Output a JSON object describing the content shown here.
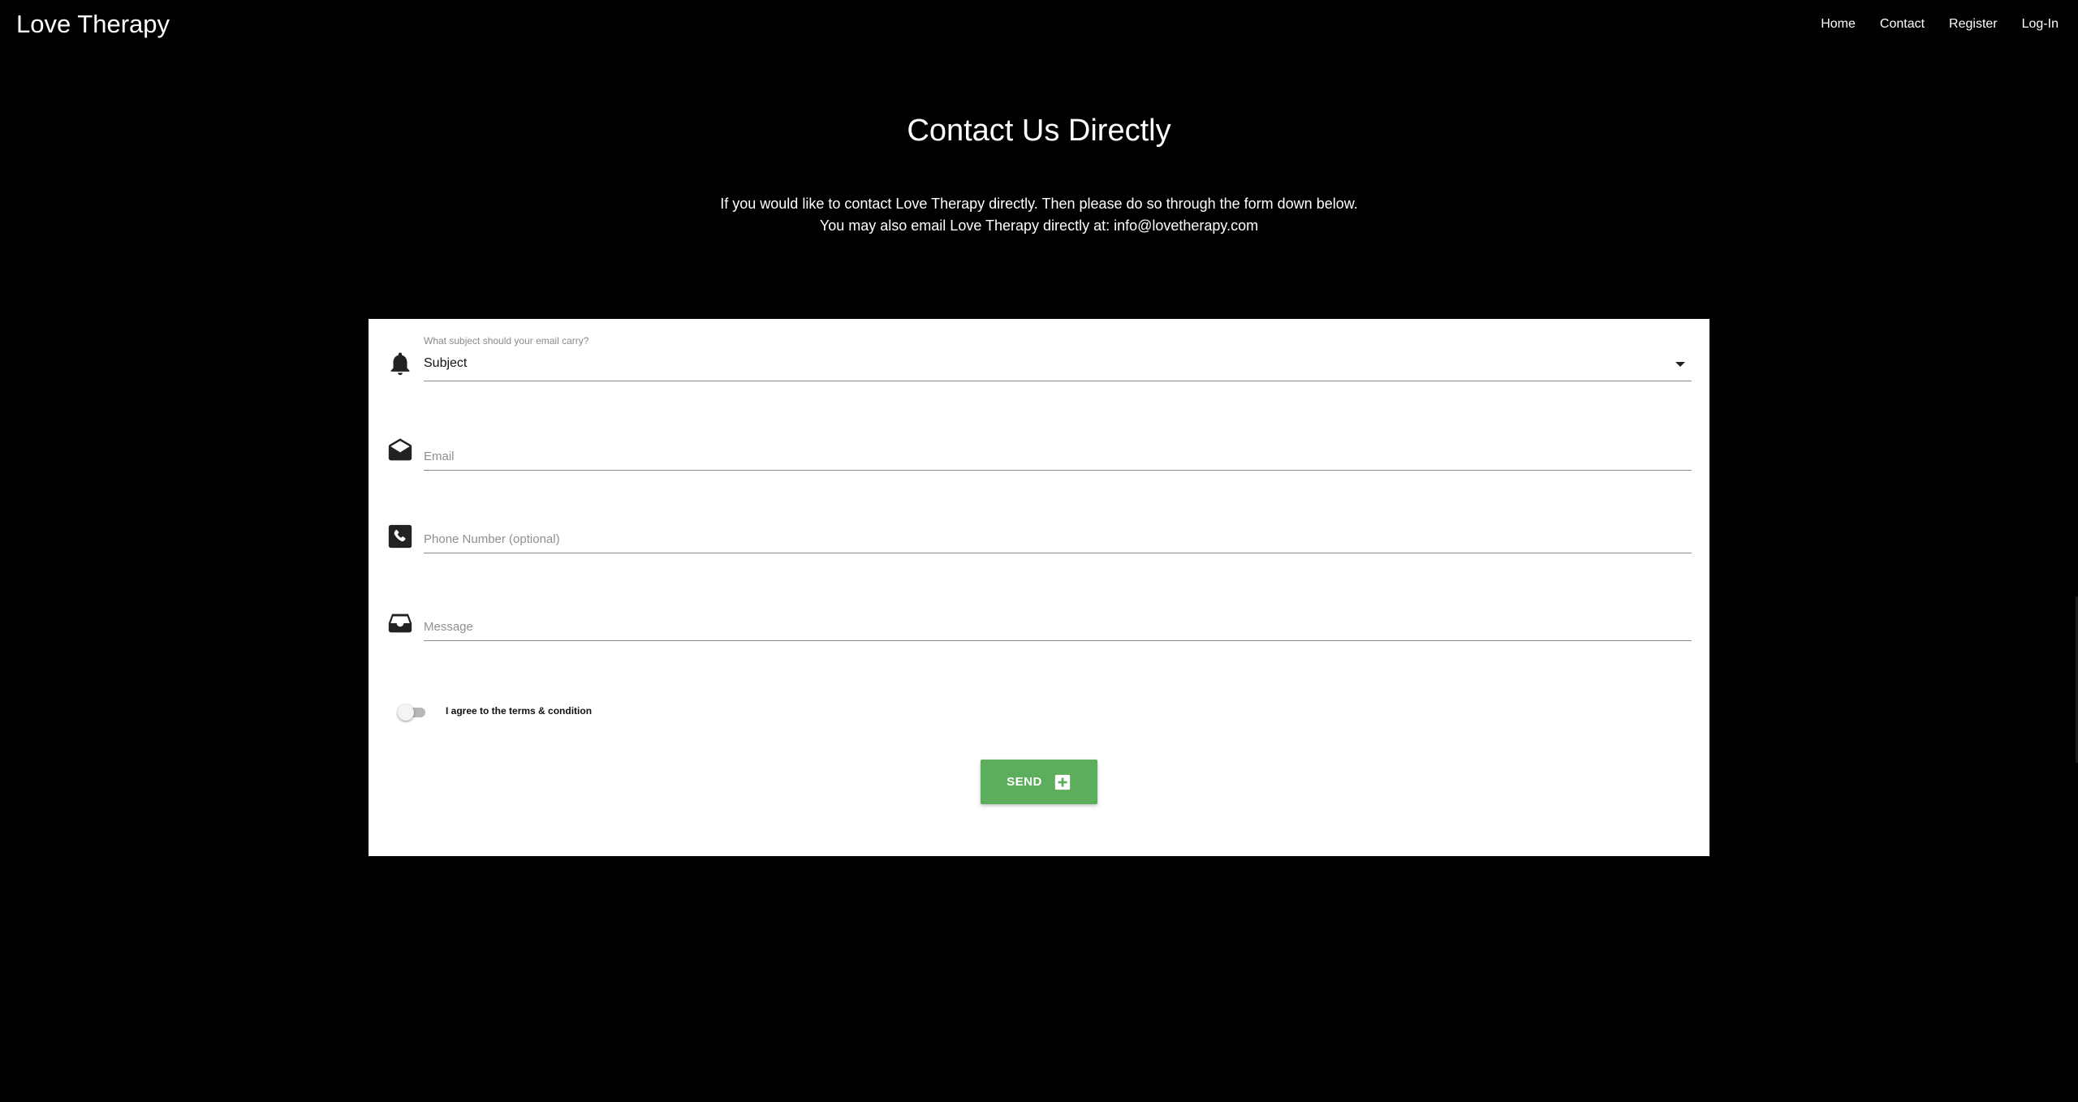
{
  "nav": {
    "brand": "Love Therapy",
    "links": [
      "Home",
      "Contact",
      "Register",
      "Log-In"
    ]
  },
  "page": {
    "title": "Contact Us Directly",
    "intro_line1": "If you would like to contact Love Therapy directly. Then please do so through the form down below.",
    "intro_line2": "You may also email Love Therapy directly at: info@lovetherapy.com"
  },
  "form": {
    "subject": {
      "helper": "What subject should your email carry?",
      "value": "Subject",
      "icon": "bell-icon"
    },
    "email": {
      "placeholder": "Email",
      "value": "",
      "icon": "mail-icon"
    },
    "phone": {
      "placeholder": "Phone Number (optional)",
      "value": "",
      "icon": "phone-icon"
    },
    "message": {
      "placeholder": "Message",
      "value": "",
      "icon": "inbox-icon"
    },
    "terms": {
      "label": "I agree to the terms & condition",
      "checked": false
    },
    "send_label": "SEND",
    "send_icon": "plus-box-icon"
  },
  "colors": {
    "background": "#000000",
    "card": "#ffffff",
    "send_button": "#5cad5c",
    "text_light": "#ffffff"
  }
}
